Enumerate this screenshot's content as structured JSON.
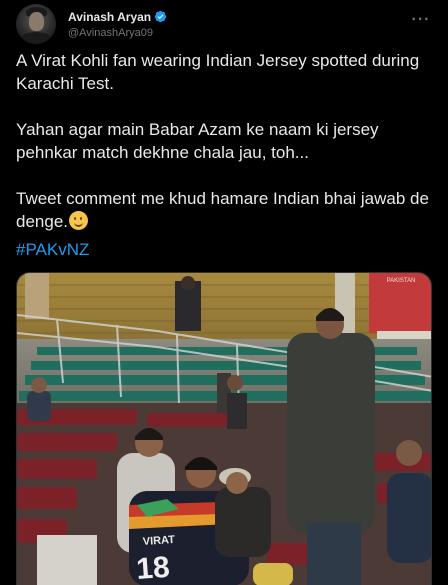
{
  "author": {
    "display_name": "Avinash Aryan",
    "handle": "@AvinashArya09",
    "verified": true,
    "verified_color": "#1d9bf0"
  },
  "tweet": {
    "paragraphs": [
      "A Virat Kohli fan wearing Indian Jersey spotted during Karachi Test.",
      "Yahan agar main Babar Azam ke naam ki jersey pehnkar match dekhne chala jau, toh...",
      "Tweet comment me khud hamare Indian bhai jawab de denge."
    ],
    "emoji": "slightly-smiling-face",
    "hashtag": "#PAKvNZ",
    "hashtag_color": "#1d9bf0"
  },
  "media": {
    "jersey_text": "VIRAT",
    "jersey_number": "18",
    "banner_text": "PAKISTAN"
  },
  "icons": {
    "more": "more-options-icon",
    "verified": "verified-badge-icon"
  },
  "theme": {
    "background": "#000000",
    "text": "#e7e9ea",
    "secondary_text": "#71767b"
  }
}
